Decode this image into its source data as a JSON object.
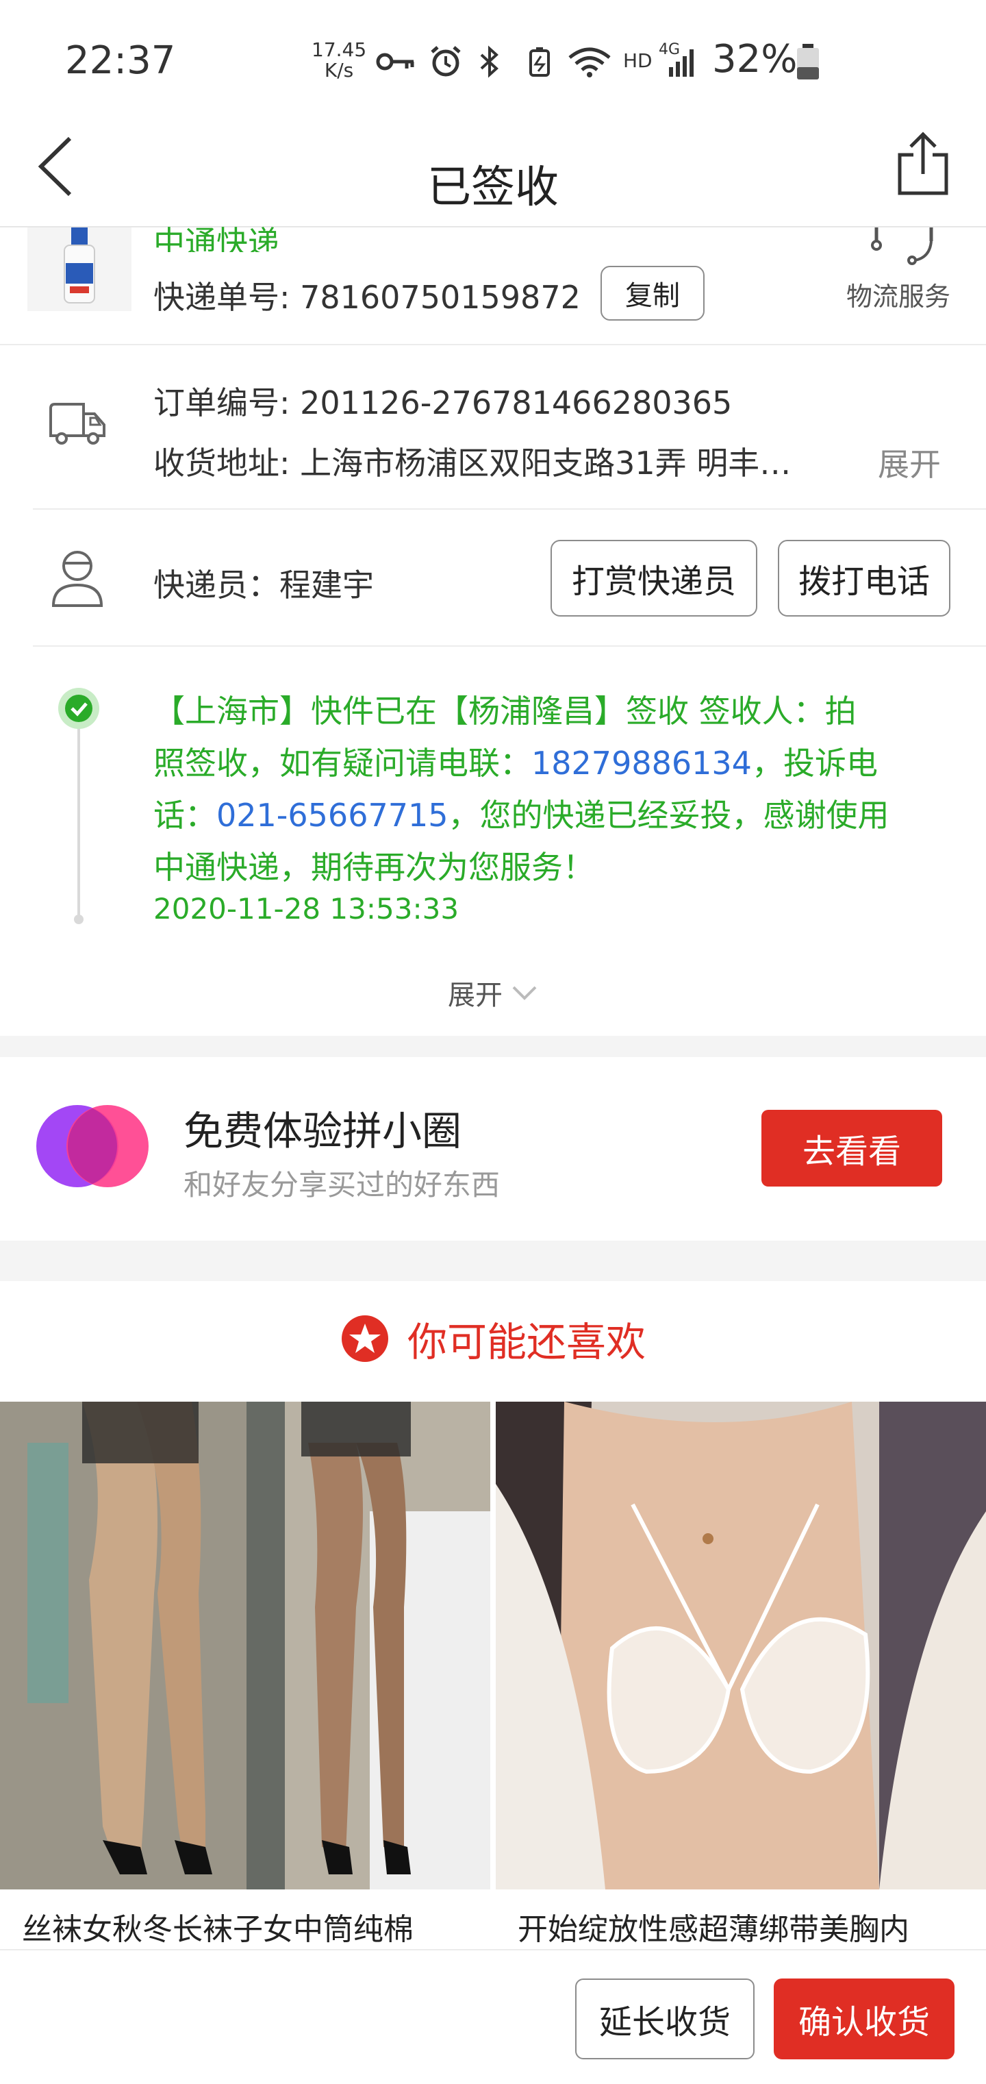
{
  "status_bar": {
    "time": "22:37",
    "net_speed_value": "17.45",
    "net_speed_unit": "K/s",
    "network_label": "HD",
    "network_type": "4G",
    "battery": "32%",
    "icons": [
      "key-icon",
      "alarm-icon",
      "bluetooth-icon",
      "battery-saver-icon",
      "wifi-icon",
      "signal-icon",
      "battery-icon"
    ]
  },
  "header": {
    "title": "已签收",
    "back_icon": "chevron-left-icon",
    "share_icon": "share-icon"
  },
  "shipment": {
    "carrier": "中通快递",
    "tracking_label": "快递单号: 78160750159872",
    "copy_label": "复制",
    "logistics_service": "物流服务"
  },
  "order": {
    "order_no": "订单编号: 201126-276781466280365",
    "address": "收货地址: 上海市杨浦区双阳支路31弄 明丰…",
    "expand_label": "展开"
  },
  "courier": {
    "name": "快递员：程建宇",
    "tip_label": "打赏快递员",
    "call_label": "拨打电话"
  },
  "tracking_event": {
    "text_part1": "【上海市】快件已在【杨浦隆昌】签收 签收人：拍",
    "text_part2": "照签收，如有疑问请电联：",
    "phone1": "18279886134",
    "text_part3": "，投诉电",
    "text_part4": "话：",
    "phone2": "021-65667715",
    "text_part5": "，您的快递已经妥投，感谢使用",
    "text_part6": "中通快递，期待再次为您服务！",
    "timestamp": "2020-11-28 13:53:33",
    "expand_label": "展开"
  },
  "promo": {
    "title": "免费体验拼小圈",
    "subtitle": "和好友分享买过的好东西",
    "button_label": "去看看"
  },
  "recommend": {
    "heading": "你可能还喜欢",
    "items": [
      {
        "title": "丝袜女秋冬长袜子女中筒纯棉"
      },
      {
        "title": "开始绽放性感超薄绑带美胸内"
      }
    ]
  },
  "bottom_bar": {
    "extend_label": "延长收货",
    "confirm_label": "确认收货"
  },
  "colors": {
    "accent_red": "#e02e24",
    "status_green": "#2aab29",
    "link_blue": "#2f6ed8"
  }
}
